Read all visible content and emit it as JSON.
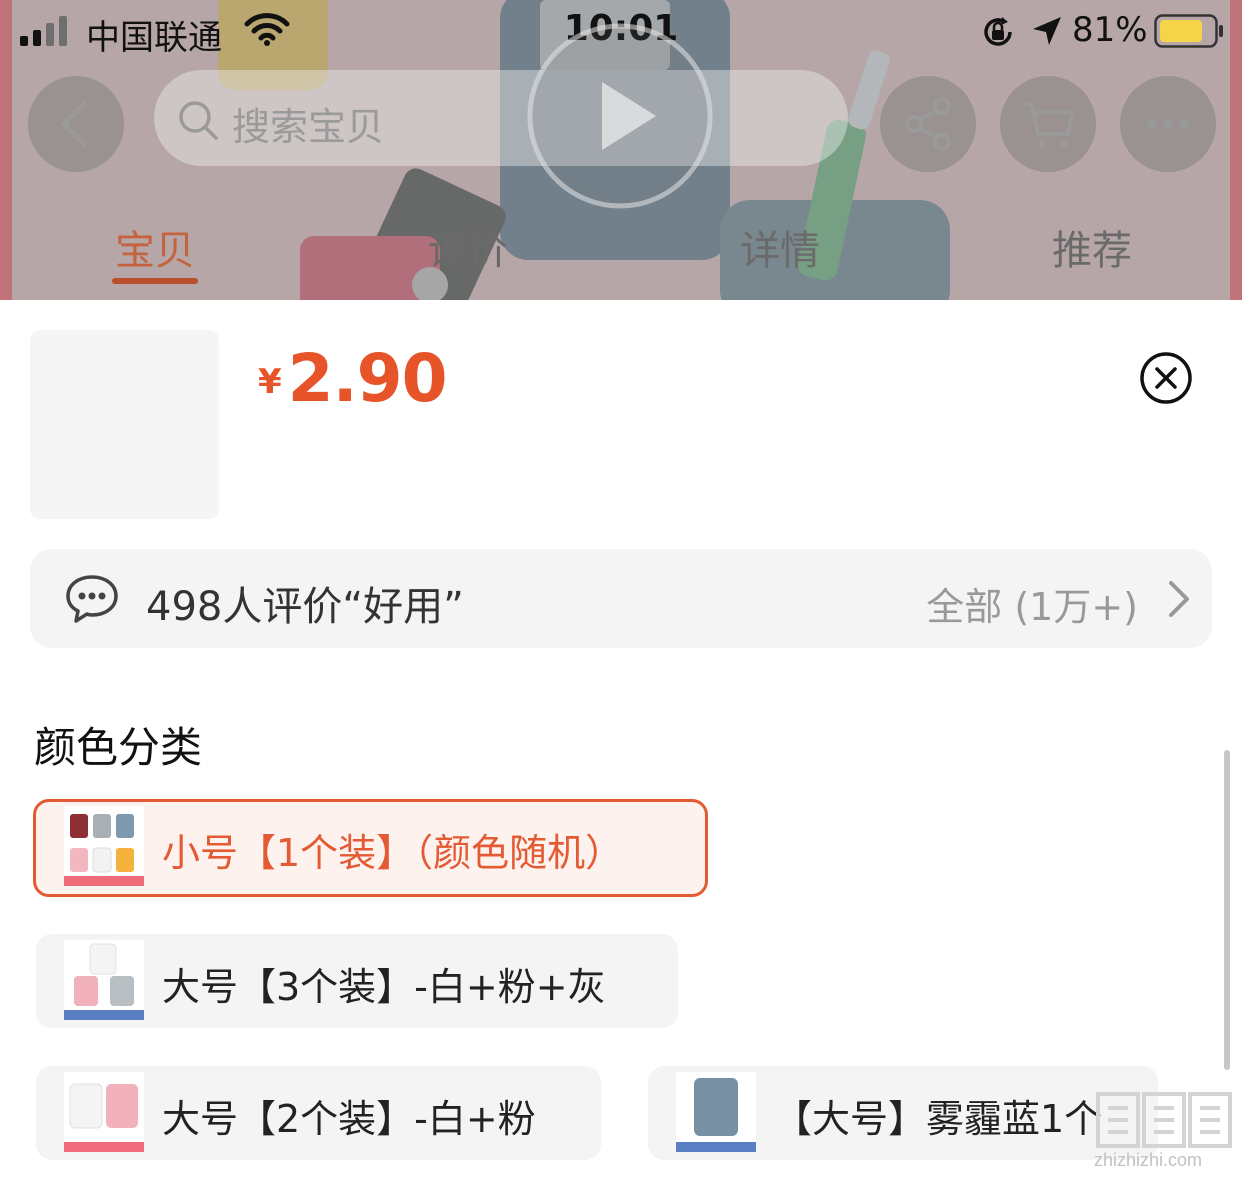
{
  "status_bar": {
    "carrier": "中国联通",
    "time": "10:01",
    "battery_percent": "81%",
    "battery_level": 0.81,
    "battery_color": "#f6d44a",
    "signal_bars_filled": 2
  },
  "header": {
    "search_placeholder": "搜索宝贝",
    "icons": [
      "back-icon",
      "search-icon",
      "play-icon",
      "share-icon",
      "cart-icon",
      "more-icon"
    ],
    "tabs": [
      {
        "label": "宝贝",
        "active": true
      },
      {
        "label": "评价",
        "active": false
      },
      {
        "label": "详情",
        "active": false
      },
      {
        "label": "推荐",
        "active": false
      }
    ]
  },
  "sheet": {
    "price_currency": "¥",
    "price_amount": "2.90",
    "review": {
      "text": "498人评价“好用”",
      "all_label": "全部 (1万+)"
    },
    "section_title": "颜色分类",
    "options": [
      {
        "label": "小号【1个装】（颜色随机）",
        "selected": true
      },
      {
        "label": "大号【3个装】-白+粉+灰",
        "selected": false
      },
      {
        "label": "大号【2个装】-白+粉",
        "selected": false
      },
      {
        "label": "【大号】雾霾蓝1个",
        "selected": false
      }
    ]
  },
  "colors": {
    "accent": "#e35a33",
    "price": "#e8542a",
    "tab_active": "#c4643e"
  },
  "watermark": {
    "logo": "值值值",
    "site": "zhizhizhi.com"
  }
}
